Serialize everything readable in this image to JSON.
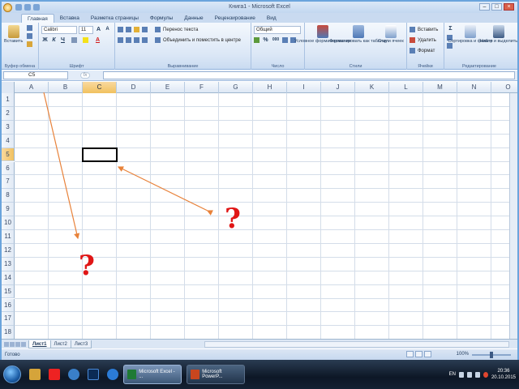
{
  "window": {
    "title": "Книга1 - Microsoft Excel",
    "controls": [
      "–",
      "□",
      "×"
    ]
  },
  "ribbon": {
    "tabs": [
      "Главная",
      "Вставка",
      "Разметка страницы",
      "Формулы",
      "Данные",
      "Рецензирование",
      "Вид"
    ],
    "active_tab": "Главная",
    "groups": {
      "clipboard": {
        "label": "Буфер обмена",
        "paste": "Вставить"
      },
      "font": {
        "label": "Шрифт",
        "font_name": "Calibri",
        "font_size": "11",
        "bold": "Ж",
        "italic": "К",
        "underline": "Ч",
        "grow": "A",
        "shrink": "A",
        "font_color": "A"
      },
      "alignment": {
        "label": "Выравнивание",
        "wrap_text": "Перенос текста",
        "merge": "Объединить и поместить в центре"
      },
      "number": {
        "label": "Число",
        "format": "Общий",
        "percent": "%",
        "thousands": "000"
      },
      "styles": {
        "label": "Стили",
        "conditional": "Условное форматирование",
        "as_table": "Форматировать как таблицу",
        "cell_styles": "Стили ячеек"
      },
      "cells": {
        "label": "Ячейки",
        "insert": "Вставить",
        "delete": "Удалить",
        "format": "Формат"
      },
      "editing": {
        "label": "Редактирование",
        "sum": "Σ",
        "sort": "Сортировка и фильтр",
        "find": "Найти и выделить"
      }
    }
  },
  "formula_bar": {
    "name_box": "C5",
    "fx": "fx",
    "value": ""
  },
  "grid": {
    "columns": [
      "A",
      "B",
      "C",
      "D",
      "E",
      "F",
      "G",
      "H",
      "I",
      "J",
      "K",
      "L",
      "M",
      "N",
      "O"
    ],
    "rows": [
      "1",
      "2",
      "3",
      "4",
      "5",
      "6",
      "7",
      "8",
      "9",
      "10",
      "11",
      "12",
      "13",
      "14",
      "15",
      "16",
      "17",
      "18"
    ],
    "active_column": "C",
    "active_row": "5",
    "question_mark": "?"
  },
  "sheets": {
    "tabs": [
      "Лист1",
      "Лист2",
      "Лист3"
    ],
    "active": "Лист1"
  },
  "status": {
    "text": "Готово",
    "zoom": "100%"
  },
  "taskbar": {
    "apps": [
      {
        "label": "Microsoft Excel - ...",
        "color": "#1f7a35"
      },
      {
        "label": "Microsoft PowerP...",
        "color": "#c8461f"
      }
    ],
    "language": "EN",
    "time": "20:36",
    "date": "20.10.2015"
  },
  "colors": {
    "accent": "#6ba4dc",
    "arrow": "#e8823a",
    "question": "#e01616",
    "selected_header": "#f1c15f"
  }
}
